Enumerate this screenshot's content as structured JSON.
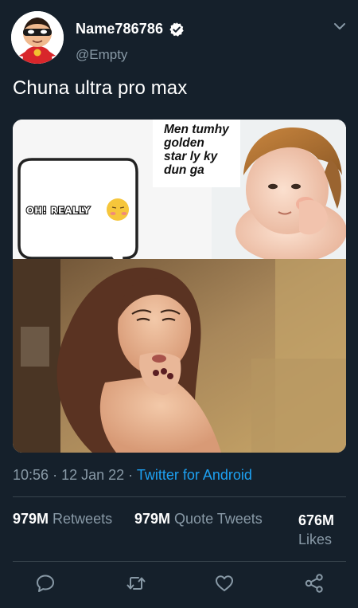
{
  "header": {
    "display_name": "Name786786",
    "handle": "@Empty",
    "avatar_icon": "incredibles-avatar",
    "verified_icon": "verified-badge-icon",
    "menu_icon": "chevron-down-icon"
  },
  "tweet": {
    "text": "Chuna ultra pro max",
    "media": {
      "caption": "Men tumhy\ngolden\n star ly ky\ndun ga",
      "bubble_text": "OH! REALLY"
    }
  },
  "meta": {
    "time": "10:56",
    "separator": "·",
    "date": "12 Jan 22",
    "source": "Twitter for Android"
  },
  "stats": {
    "retweets_count": "979M",
    "retweets_label": "Retweets",
    "quote_count": "979M",
    "quote_label": "Quote Tweets",
    "likes_count": "676M",
    "likes_label": "Likes"
  },
  "actions": {
    "reply_icon": "reply-icon",
    "retweet_icon": "retweet-icon",
    "like_icon": "heart-icon",
    "share_icon": "share-icon"
  },
  "colors": {
    "background": "#15202b",
    "text_primary": "#ffffff",
    "text_secondary": "#8899a6",
    "accent": "#1da1f2",
    "divider": "#38444d"
  }
}
